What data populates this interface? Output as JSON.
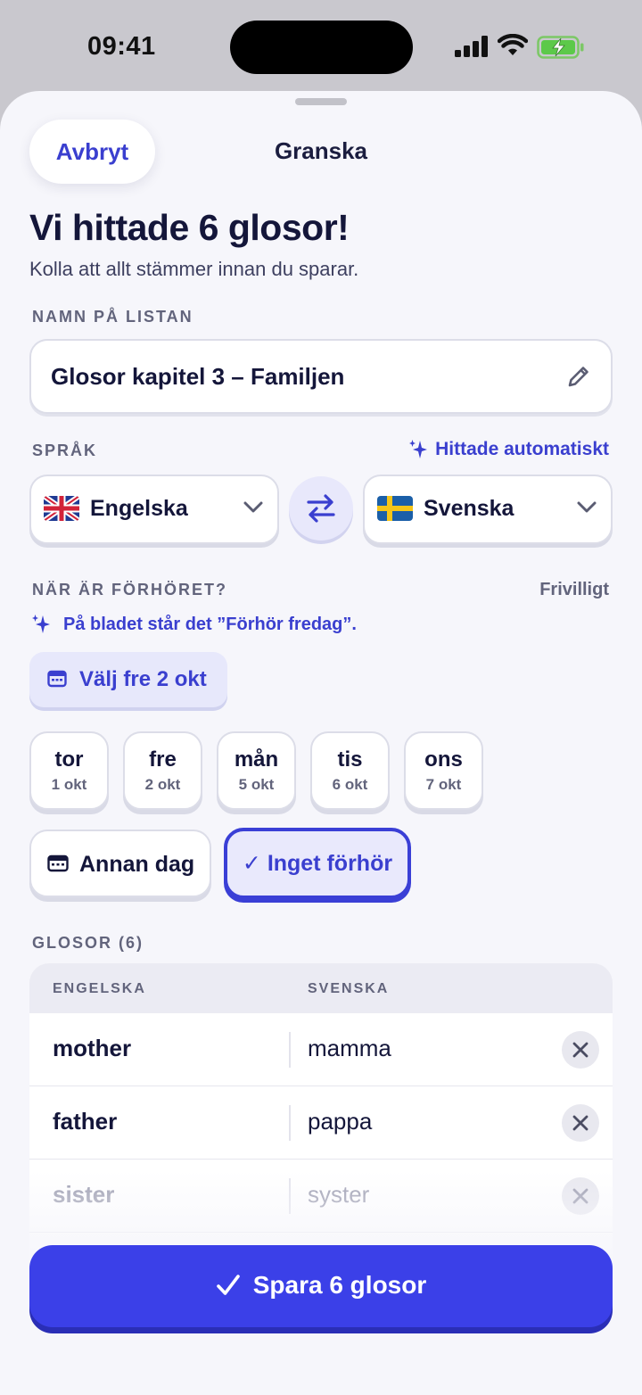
{
  "status_bar": {
    "time": "09:41"
  },
  "nav": {
    "cancel_label": "Avbryt",
    "title": "Granska"
  },
  "header": {
    "headline": "Vi hittade 6 glosor!",
    "subline": "Kolla att allt stämmer innan du sparar."
  },
  "list_name": {
    "label": "NAMN PÅ LISTAN",
    "value": "Glosor kapitel 3 – Familjen"
  },
  "language": {
    "label": "SPRÅK",
    "auto_detect": "Hittade automatiskt",
    "source": "Engelska",
    "target": "Svenska"
  },
  "test_date": {
    "label": "NÄR ÄR FÖRHÖRET?",
    "optional": "Frivilligt",
    "hint": "På bladet står det ”Förhör fredag”.",
    "suggest_button": "Välj fre 2 okt",
    "days": [
      {
        "weekday": "tor",
        "date": "1 okt"
      },
      {
        "weekday": "fre",
        "date": "2 okt"
      },
      {
        "weekday": "mån",
        "date": "5 okt"
      },
      {
        "weekday": "tis",
        "date": "6 okt"
      },
      {
        "weekday": "ons",
        "date": "7 okt"
      }
    ],
    "other_day": "Annan dag",
    "no_test": "✓ Inget förhör"
  },
  "words": {
    "label": "GLOSOR (6)",
    "col_source": "ENGELSKA",
    "col_target": "SVENSKA",
    "rows": [
      {
        "source": "mother",
        "target": "mamma"
      },
      {
        "source": "father",
        "target": "pappa"
      },
      {
        "source": "sister",
        "target": "syster"
      }
    ]
  },
  "save_button": "Spara 6 glosor",
  "colors": {
    "accent": "#3b40e8",
    "background": "#f6f6fb",
    "text": "#14163a"
  }
}
